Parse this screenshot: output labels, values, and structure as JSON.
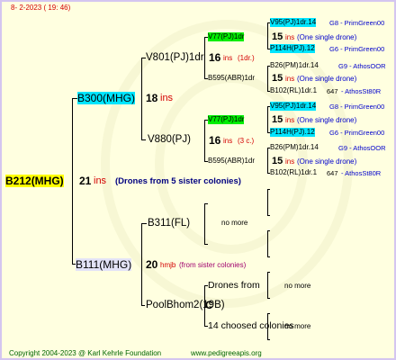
{
  "header": {
    "date": "8-  2-2023 ( 19: 46)"
  },
  "root": {
    "name": "B212(MHG)",
    "gen": "21",
    "note": "ins",
    "desc": "(Drones from 5 sister colonies)"
  },
  "n_b300": {
    "name": "B300(MHG)",
    "gen": "18",
    "note": "ins"
  },
  "n_v801": {
    "name": "V801(PJ)1dr",
    "gen": "16",
    "note": "ins",
    "extra": "(1dr.)"
  },
  "n_v77a": {
    "name": "V77(PJ)1dr",
    "gen": "15",
    "note": "ins",
    "extra": "(One single drone)"
  },
  "n_v95a": {
    "name": "V95(PJ)1dr.14",
    "tag": "G8 - PrimGreen00"
  },
  "n_p114a": {
    "name": "P114H(PJ).12",
    "tag": "G6 - PrimGreen00"
  },
  "n_b595a": {
    "name": "B595(ABR)1dr",
    "gen": "15",
    "note": "ins",
    "extra": "(One single drone)"
  },
  "n_b26a": {
    "name": "B26(PM)1dr.14",
    "tag": "G9 - AthosOOR"
  },
  "n_b102a": {
    "name": "B102(RL)1dr.1",
    "mid": "647",
    "tag": "- AthosSt80R"
  },
  "n_v880": {
    "name": "V880(PJ)",
    "gen": "16",
    "note": "ins",
    "extra": "(3 c.)"
  },
  "n_v77b": {
    "name": "V77(PJ)1dr",
    "gen": "15",
    "note": "ins",
    "extra": "(One single drone)"
  },
  "n_v95b": {
    "name": "V95(PJ)1dr.14",
    "tag": "G8 - PrimGreen00"
  },
  "n_p114b": {
    "name": "P114H(PJ).12",
    "tag": "G6 - PrimGreen00"
  },
  "n_b595b": {
    "name": "B595(ABR)1dr",
    "gen": "15",
    "note": "ins",
    "extra": "(One single drone)"
  },
  "n_b26b": {
    "name": "B26(PM)1dr.14",
    "tag": "G9 - AthosOOR"
  },
  "n_b102b": {
    "name": "B102(RL)1dr.1",
    "mid": "647",
    "tag": "- AthosSt80R"
  },
  "n_b311": {
    "name": "B311(FL)",
    "more": "no more"
  },
  "n_b111": {
    "name": "B111(MHG)",
    "gen": "20",
    "note": "hmjb",
    "extra": "(from sister colonies)"
  },
  "n_drones": {
    "name": "Drones from",
    "more": "no more"
  },
  "n_poolb": {
    "name": "PoolBhom2(19B)",
    "overlay": "C"
  },
  "n_chosen": {
    "name": "14 choosed colonies",
    "more": "no more"
  },
  "footer": {
    "copyright": "Copyright 2004-2023 @ Karl Kehrle Foundation",
    "site": "www.pedigreeapis.org"
  },
  "colors": {
    "background": "#ffffe0",
    "root_hl": "#ffff00",
    "queen_hl": "#00e5ff",
    "drone_hl": "#00ee00",
    "note_red": "#d40000",
    "tag_blue": "#0000cc",
    "footer_green": "#006400"
  }
}
